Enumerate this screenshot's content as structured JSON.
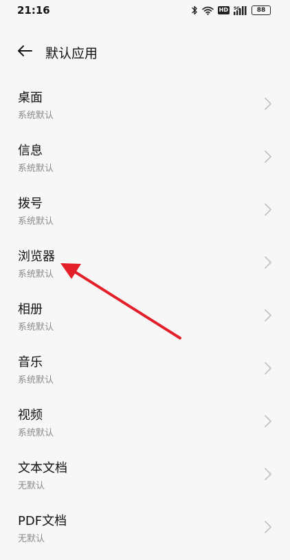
{
  "status_bar": {
    "time": "21:16",
    "hd_label": "HD",
    "network_label": "5G",
    "battery_level": "88"
  },
  "header": {
    "title": "默认应用"
  },
  "items": [
    {
      "title": "桌面",
      "subtitle": "系统默认"
    },
    {
      "title": "信息",
      "subtitle": "系统默认"
    },
    {
      "title": "拨号",
      "subtitle": "系统默认"
    },
    {
      "title": "浏览器",
      "subtitle": "系统默认"
    },
    {
      "title": "相册",
      "subtitle": "系统默认"
    },
    {
      "title": "音乐",
      "subtitle": "系统默认"
    },
    {
      "title": "视频",
      "subtitle": "系统默认"
    },
    {
      "title": "文本文档",
      "subtitle": "无默认"
    },
    {
      "title": "PDF文档",
      "subtitle": "无默认"
    }
  ],
  "colors": {
    "background": "#f7f7f7",
    "annotation_arrow": "#e3202a",
    "chevron": "#c2c2c2",
    "subtitle": "#8a8a8a"
  },
  "icons": {
    "back": "arrow-left-icon",
    "chevron": "chevron-right-icon",
    "bluetooth": "bluetooth-icon",
    "wifi": "wifi-icon",
    "signal": "cellular-signal-icon",
    "battery": "battery-icon"
  }
}
